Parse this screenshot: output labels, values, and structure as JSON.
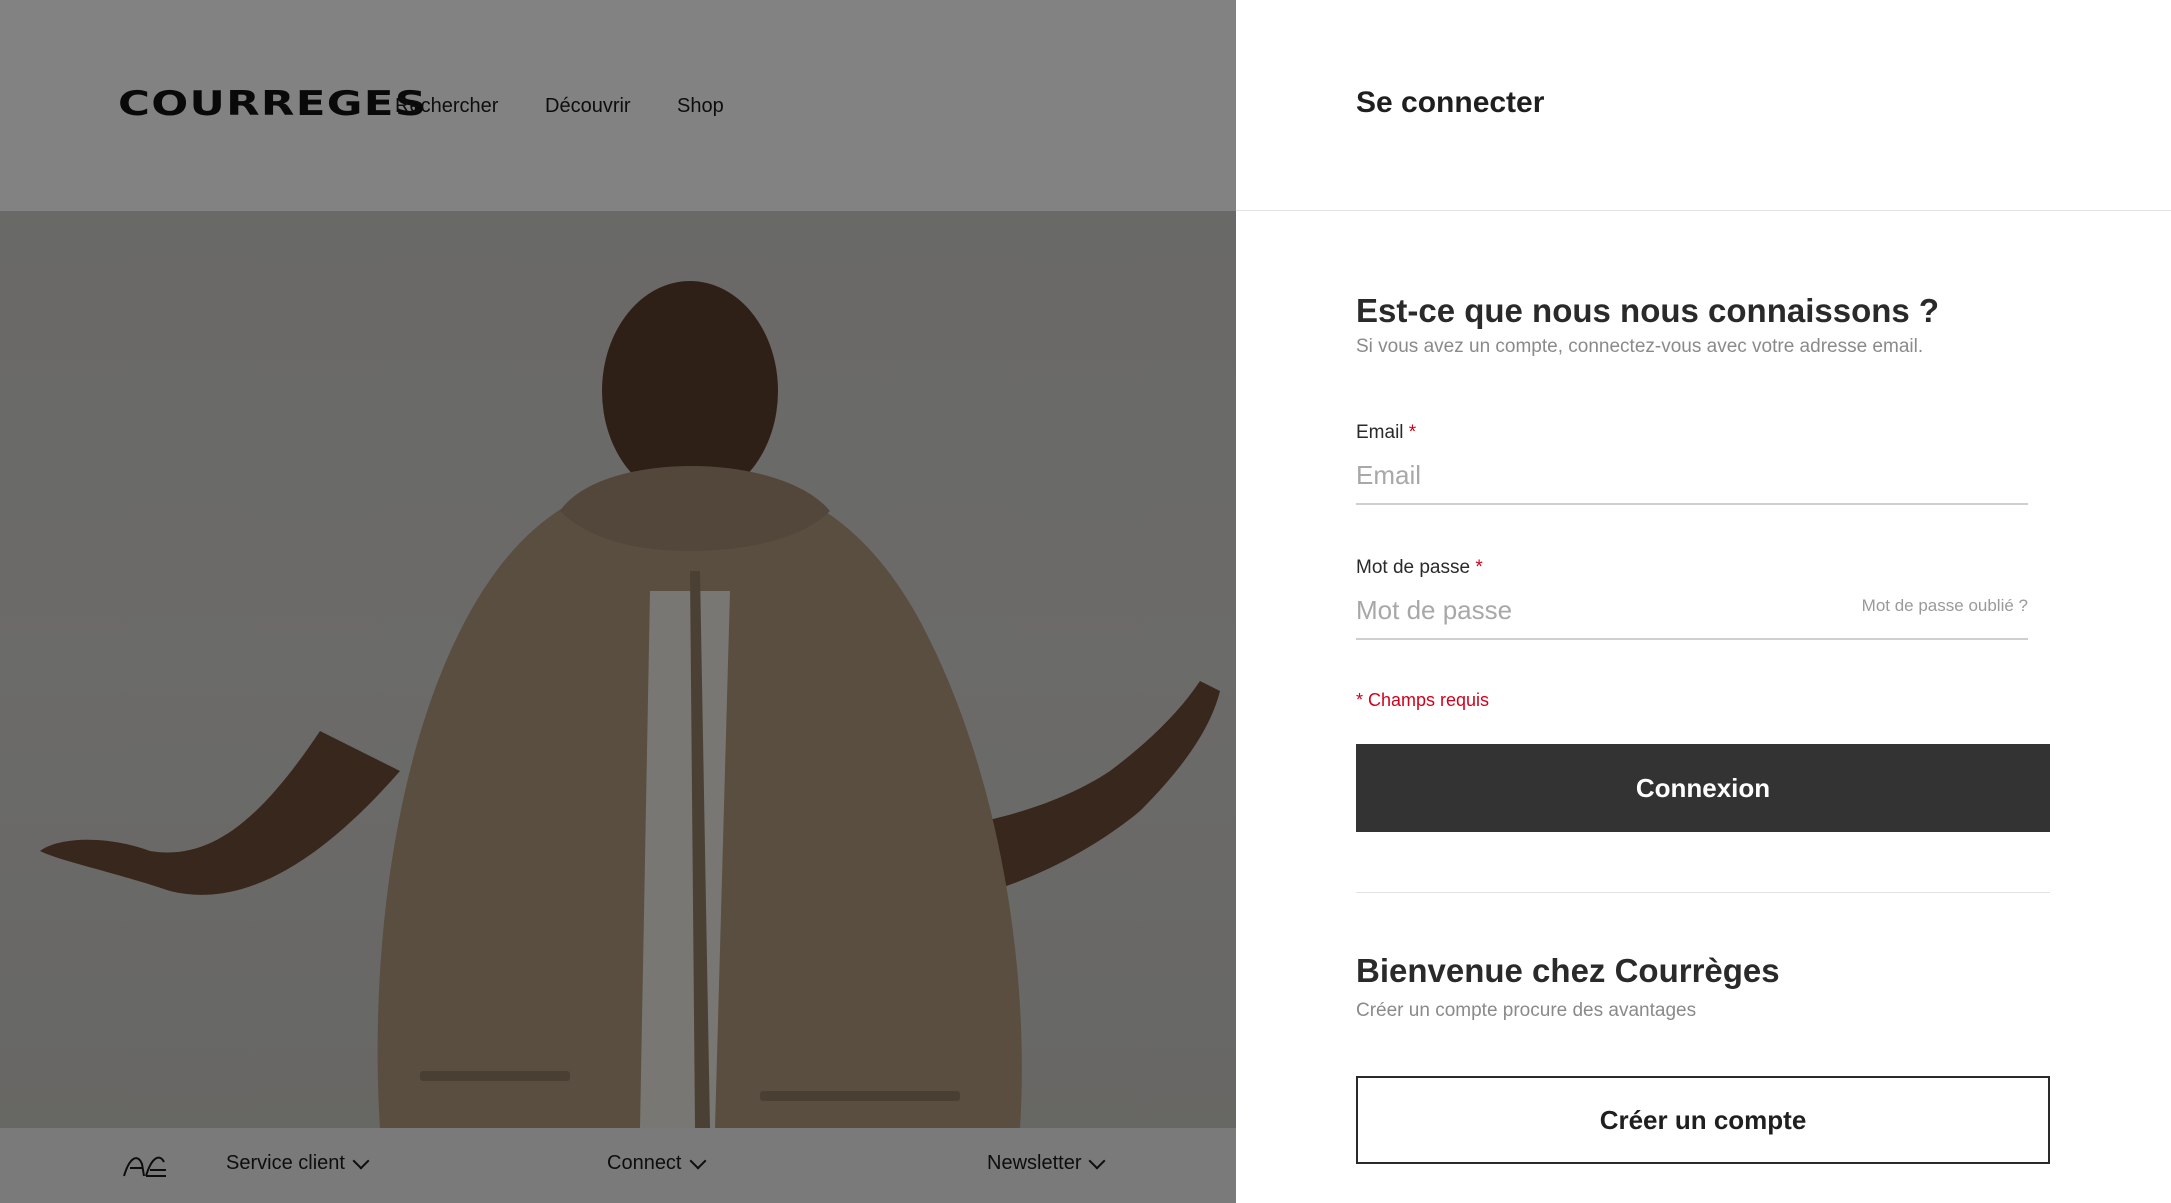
{
  "site": {
    "logo": "COURREGES",
    "nav": [
      "Rechercher",
      "Découvrir",
      "Shop"
    ],
    "footer": {
      "items": [
        "Service client",
        "Connect",
        "Newsletter"
      ]
    }
  },
  "panel": {
    "title": "Se connecter",
    "login": {
      "heading": "Est-ce que nous nous connaissons ?",
      "subtitle": "Si vous avez un compte, connectez-vous avec votre adresse email.",
      "email_label": "Email",
      "email_placeholder": "Email",
      "password_label": "Mot de passe",
      "password_placeholder": "Mot de passe",
      "required_mark": "*",
      "forgot": "Mot de passe oublié ?",
      "required_note": "* Champs requis",
      "submit": "Connexion"
    },
    "register": {
      "heading": "Bienvenue chez Courrèges",
      "subtitle": "Créer un compte procure des avantages",
      "button": "Créer un compte"
    }
  },
  "colors": {
    "accent": "#333333",
    "required": "#d0021b",
    "overlay": "rgba(0,0,0,0.47)"
  }
}
